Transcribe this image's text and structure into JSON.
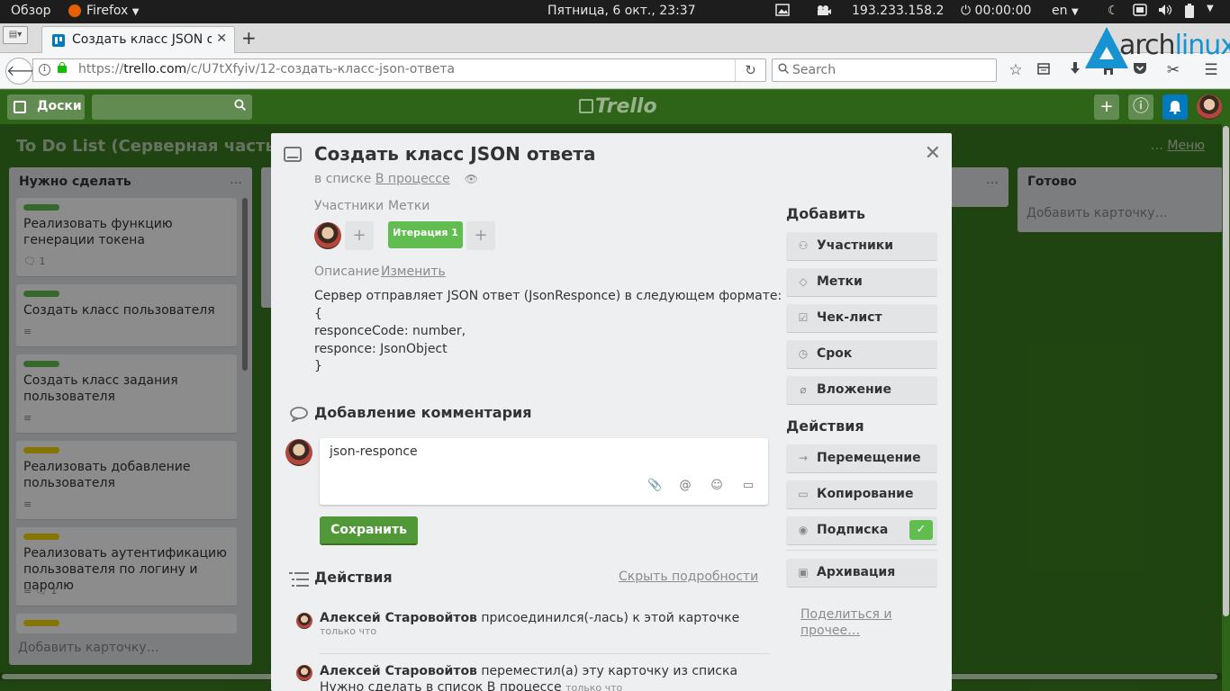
{
  "gnome": {
    "activities": "Обзор",
    "app_name": "Firefox",
    "clock": "Пятница,  6 окт., 23:37",
    "ip": "193.233.158.2",
    "timer": "00:00:00",
    "keyboard_layout": "en"
  },
  "browser": {
    "tab_title": "Создать класс JSON ответа",
    "url_prefix": "https://",
    "url_domain": "trello.com",
    "url_path": "/c/U7tXfyiv/12-создать-класс-json-ответа",
    "search_placeholder": "Search"
  },
  "branding": {
    "arch_text": "arch",
    "arch_text_2": "linux"
  },
  "trello": {
    "boards_label": "Доски",
    "logo": "Trello",
    "board_title": "To Do List (Серверная часть)",
    "menu_dots": "…",
    "menu_label": "Меню"
  },
  "lists": [
    {
      "title": "Нужно сделать",
      "cards": [
        {
          "label_color": "#61bd4f",
          "title": "Реализовать функцию генерации токена",
          "badge": "1"
        },
        {
          "label_color": "#61bd4f",
          "title": "Создать класс пользователя",
          "badge": ""
        },
        {
          "label_color": "#61bd4f",
          "title": "Создать класс задания пользователя",
          "badge": ""
        },
        {
          "label_color": "#f2d600",
          "title": "Реализовать добавление пользователя",
          "badge": ""
        },
        {
          "label_color": "#f2d600",
          "title": "Реализовать аутентификацию пользователя по логину и паролю",
          "badge": "1"
        }
      ],
      "add_card": "Добавить карточку…"
    },
    {
      "title": "Готово",
      "cards": [],
      "add_card": "Добавить карточку…"
    }
  ],
  "modal": {
    "title": "Создать класс JSON ответа",
    "in_list_prefix": "в списке",
    "list_name": "В процессе",
    "members_label": "Участники",
    "labels_label": "Метки",
    "label_chip": "Итерация 1",
    "description_label": "Описание",
    "edit_link": "Изменить",
    "description_lines": [
      "Сервер отправляет JSON ответ (JsonResponce) в следующем формате:",
      "{",
      "responceCode: number,",
      "responce: JsonObject",
      "}"
    ],
    "add_comment_heading": "Добавление комментария",
    "comment_value": "json-responce",
    "save_label": "Сохранить",
    "actions_heading": "Действия",
    "hide_details": "Скрыть подробности",
    "activity": [
      {
        "user": "Алексей Старовойтов",
        "text": " присоединился(-лась) к этой карточке",
        "time": "только что"
      },
      {
        "user": "Алексей Старовойтов",
        "text": " переместил(а) эту карточку из списка Нужно сделать в список В процессе",
        "time": "только что"
      }
    ]
  },
  "sidebar": {
    "add_heading": "Добавить",
    "add_buttons": [
      {
        "label": "Участники",
        "icon": "person-icon"
      },
      {
        "label": "Метки",
        "icon": "tag-icon"
      },
      {
        "label": "Чек-лист",
        "icon": "checkbox-icon"
      },
      {
        "label": "Срок",
        "icon": "clock-icon"
      },
      {
        "label": "Вложение",
        "icon": "paperclip-icon"
      }
    ],
    "actions_heading": "Действия",
    "action_buttons": [
      {
        "label": "Перемещение",
        "icon": "arrow-right-icon"
      },
      {
        "label": "Копирование",
        "icon": "card-icon"
      },
      {
        "label": "Подписка",
        "icon": "eye-icon"
      },
      {
        "label": "Архивация",
        "icon": "archive-icon"
      }
    ],
    "share_line1": "Поделиться и",
    "share_line2": "прочее…"
  },
  "colors": {
    "board_bg": "#3a7d1f",
    "label_green": "#61bd4f",
    "label_yellow": "#f2d600",
    "save_green": "#519839"
  }
}
